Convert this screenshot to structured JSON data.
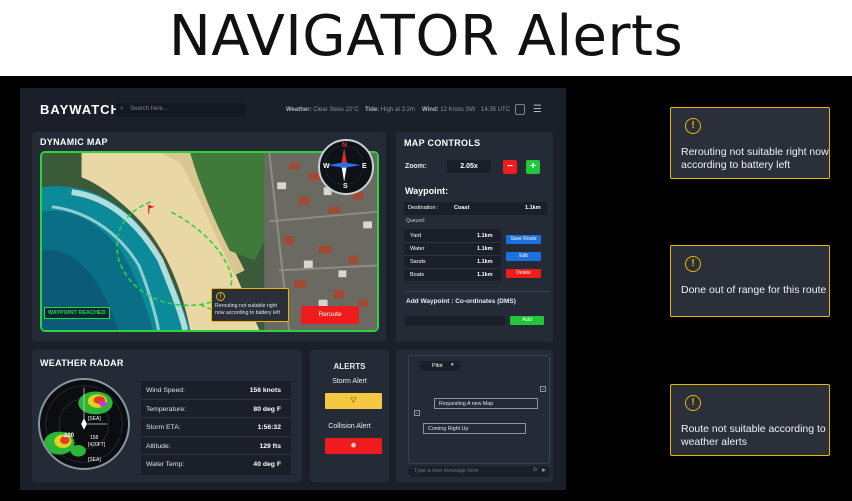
{
  "page_title": "NAVIGATOR Alerts",
  "app": {
    "brand": "BAYWATCH",
    "search_placeholder": "Search here...",
    "weather_label": "Weather:",
    "weather_value": "Clear Skies 22°C",
    "tide_label": "Tide:",
    "tide_value": "High at 3.2m",
    "wind_label": "Wind:",
    "wind_value": "12 Knots SW",
    "time": "14:35 UTC"
  },
  "map": {
    "title": "DYNAMIC MAP",
    "waypoint_status": "WAYPOINT REACHED",
    "alert_text": "Rerouting not suitable right now according to battery left",
    "reroute_label": "Reroute",
    "compass": {
      "n": "N",
      "s": "S",
      "e": "E",
      "w": "W"
    }
  },
  "controls": {
    "title": "MAP CONTROLS",
    "zoom_label": "Zoom:",
    "zoom_value": "2.05x",
    "zoom_out": "−",
    "zoom_in": "+",
    "waypoint_title": "Waypoint:",
    "destination_label": "Destination :",
    "destination_name": "Coast",
    "destination_dist": "1.1km",
    "queued_label": "Queued:",
    "queued": [
      {
        "name": "Yard",
        "dist": "1.1km"
      },
      {
        "name": "Water",
        "dist": "1.1km"
      },
      {
        "name": "Sands",
        "dist": "1.1km"
      },
      {
        "name": "Boats",
        "dist": "1.1km"
      }
    ],
    "save_route": "Save Route",
    "edit": "Edit",
    "delete": "Delete",
    "add_waypoint_title": "Add Waypoint : Co-ordinates (DMS)",
    "add_label": "Add"
  },
  "weather": {
    "title": "WEATHER RADAR",
    "radar_labels": {
      "top": "[SEA]",
      "mid": "290",
      "mid_right": "158",
      "sub": "[420FT]",
      "bottom": "[SEA]"
    },
    "rows": [
      {
        "key": "Wind Speed:",
        "value": "156 knots"
      },
      {
        "key": "Temperature:",
        "value": "80 deg F"
      },
      {
        "key": "Storm ETA:",
        "value": "1:56:32"
      },
      {
        "key": "Altitude:",
        "value": "129 fts"
      },
      {
        "key": "Water Temp:",
        "value": "40 deg F"
      }
    ]
  },
  "alerts": {
    "title": "ALERTS",
    "storm_label": "Storm Alert",
    "collision_label": "Collision Alert",
    "storm_color": "#f5c842",
    "collision_color": "#ee1c1c"
  },
  "chat": {
    "selector": "Pilot",
    "message_out": "Requesting A new Map",
    "message_in": "Coming Right Up",
    "input_placeholder": "Type a new message here"
  },
  "notifications": [
    {
      "text": "Rerouting not suitable right now according to battery left"
    },
    {
      "text": "Done out of range for this route"
    },
    {
      "text": "Route not suitable according to weather alerts"
    }
  ]
}
